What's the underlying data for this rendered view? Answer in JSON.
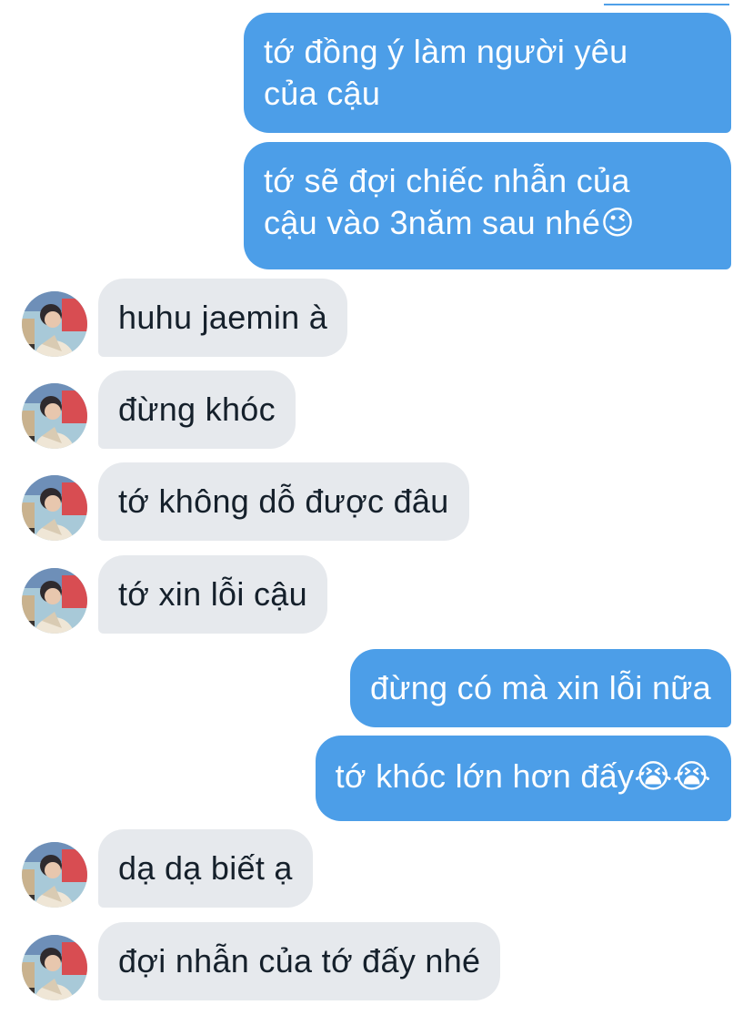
{
  "conversation": {
    "messages": [
      {
        "side": "out",
        "text_lines": [
          "tớ đồng ý làm người yêu",
          "của cậu"
        ]
      },
      {
        "side": "out",
        "text_lines": [
          "tớ sẽ đợi chiếc nhẫn của",
          "cậu vào 3năm sau nhé😉"
        ]
      },
      {
        "side": "in",
        "text": "huhu jaemin à"
      },
      {
        "side": "in",
        "text": "đừng khóc"
      },
      {
        "side": "in",
        "text": "tớ không dỗ được đâu"
      },
      {
        "side": "in",
        "text": "tớ xin lỗi cậu"
      },
      {
        "side": "out",
        "text": "đừng có mà xin lỗi nữa"
      },
      {
        "side": "out",
        "text": "tớ khóc lớn hơn đấy😭😭"
      },
      {
        "side": "in",
        "text": "dạ dạ biết ạ"
      },
      {
        "side": "in",
        "text": "đợi nhẫn của tớ đấy nhé"
      }
    ]
  },
  "colors": {
    "outgoing_bubble": "#4c9ee8",
    "incoming_bubble": "#e6e9ed",
    "incoming_text": "#15202b",
    "outgoing_text": "#ffffff"
  },
  "icons": {
    "avatar": "profile-photo-avatar"
  }
}
